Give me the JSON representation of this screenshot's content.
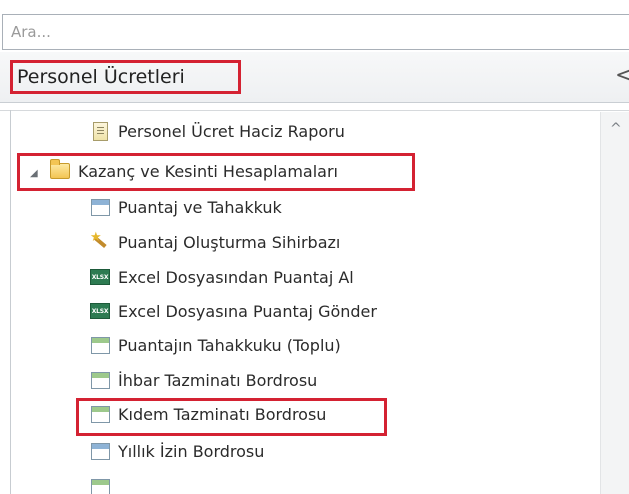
{
  "search": {
    "placeholder": "Ara..."
  },
  "panel": {
    "title": "Personel Ücretleri",
    "collapse_glyph": "<"
  },
  "tree": {
    "items": [
      {
        "label": "Personel Ücret Haciz Raporu",
        "icon": "report-icon"
      },
      {
        "label": "Kazanç ve Kesinti Hesaplamaları",
        "icon": "folder-icon",
        "expanded": true
      },
      {
        "label": "Puantaj ve Tahakkuk",
        "icon": "form-window-icon"
      },
      {
        "label": "Puantaj Oluşturma Sihirbazı",
        "icon": "wizard-icon"
      },
      {
        "label": "Excel Dosyasından Puantaj Al",
        "icon": "excel-xlsx-icon"
      },
      {
        "label": "Excel Dosyasına Puantaj Gönder",
        "icon": "excel-xlsx-icon"
      },
      {
        "label": "Puantajın Tahakkuku (Toplu)",
        "icon": "form-window-icon"
      },
      {
        "label": "İhbar Tazminatı Bordrosu",
        "icon": "form-window-icon"
      },
      {
        "label": "Kıdem Tazminatı Bordrosu",
        "icon": "form-window-icon"
      },
      {
        "label": "Yıllık İzin Bordrosu",
        "icon": "form-window-icon"
      }
    ],
    "xlsx_badge": "XLSX"
  },
  "colors": {
    "highlight": "#d42232",
    "xlsx": "#2d7b52",
    "folder": "#f3c554"
  }
}
